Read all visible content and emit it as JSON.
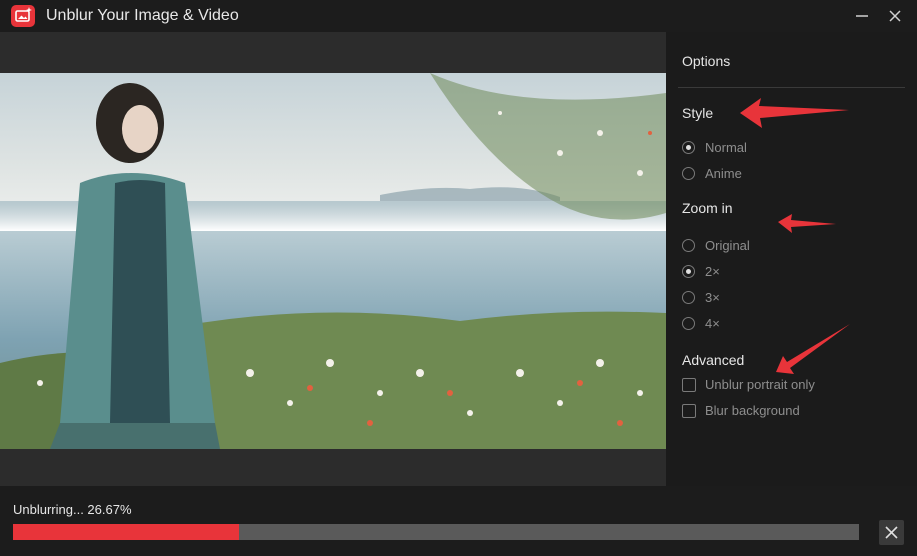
{
  "window": {
    "title": "Unblur Your Image & Video",
    "icons": {
      "app": "photo-sparkle-icon",
      "minimize": "minimize-icon",
      "close": "close-icon"
    },
    "accent": "#e8343a"
  },
  "options": {
    "title": "Options",
    "style": {
      "label": "Style",
      "items": [
        {
          "label": "Normal",
          "checked": true
        },
        {
          "label": "Anime",
          "checked": false
        }
      ]
    },
    "zoom": {
      "label": "Zoom in",
      "items": [
        {
          "label": "Original",
          "checked": false
        },
        {
          "label": "2×",
          "checked": true
        },
        {
          "label": "3×",
          "checked": false
        },
        {
          "label": "4×",
          "checked": false
        }
      ]
    },
    "advanced": {
      "label": "Advanced",
      "items": [
        {
          "label": "Unblur portrait only",
          "checked": false
        },
        {
          "label": "Blur background",
          "checked": false
        }
      ]
    }
  },
  "progress": {
    "status": "Unblurring... 26.67%",
    "percent": 26.67
  }
}
